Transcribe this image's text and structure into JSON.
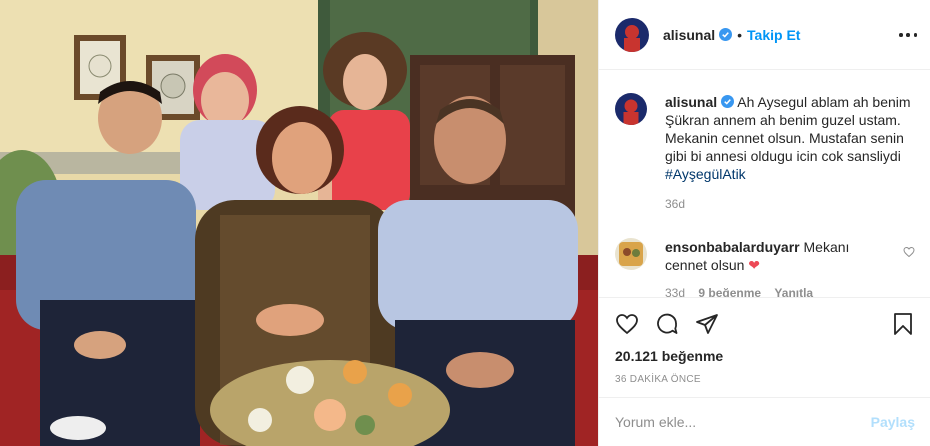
{
  "header": {
    "username": "alisunal",
    "separator": "•",
    "follow_label": "Takip Et"
  },
  "caption": {
    "username": "alisunal",
    "text": "Ah Aysegul ablam ah benim Şükran annem ah benim guzel ustam. Mekanin cennet olsun. Mustafan senin gibi bi annesi oldugu icin cok sansliydi",
    "hashtag": "#AyşegülAtik",
    "age": "36d"
  },
  "comment": {
    "username": "ensonbabalarduyarr",
    "text": "Mekanı cennet olsun",
    "emoji": "❤",
    "age": "33d",
    "likes": "9 beğenme",
    "reply_label": "Yanıtla"
  },
  "actions": {
    "likes_count": "20.121 beğenme",
    "timestamp": "36 DAKİKA ÖNCE"
  },
  "add_comment": {
    "placeholder": "Yorum ekle...",
    "post_label": "Paylaş"
  },
  "colors": {
    "accent": "#0095f6",
    "verified": "#3897f0",
    "heart_red": "#ed4956",
    "muted": "#8e8e8e"
  }
}
